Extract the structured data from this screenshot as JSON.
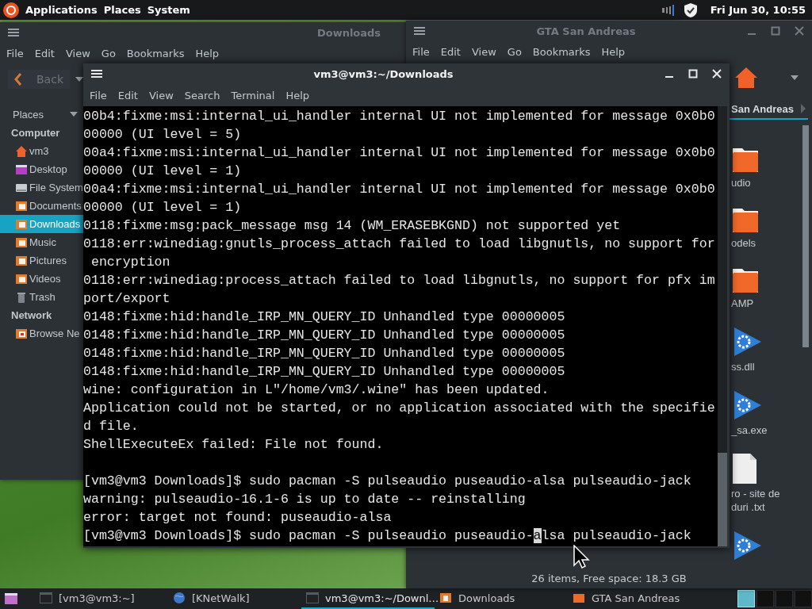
{
  "top_panel": {
    "menus": [
      "Applications",
      "Places",
      "System"
    ],
    "clock": "Fri Jun 30, 10:55"
  },
  "downloads_window": {
    "title": "Downloads",
    "active": false,
    "menus": [
      "File",
      "Edit",
      "View",
      "Go",
      "Bookmarks",
      "Help"
    ],
    "back_button": {
      "label": "Back",
      "disabled": true
    },
    "places_label": "Places",
    "sidebar": [
      {
        "heading": "Computer",
        "items": [
          {
            "kind": "home",
            "label": "vm3",
            "selected": false
          },
          {
            "kind": "desktop",
            "label": "Desktop",
            "selected": false
          },
          {
            "kind": "drive",
            "label": "File System",
            "selected": false
          },
          {
            "kind": "folder",
            "label": "Documents",
            "selected": false
          },
          {
            "kind": "folder",
            "label": "Downloads",
            "selected": true
          },
          {
            "kind": "folder",
            "label": "Music",
            "selected": false
          },
          {
            "kind": "folder",
            "label": "Pictures",
            "selected": false
          },
          {
            "kind": "folder",
            "label": "Videos",
            "selected": false
          },
          {
            "kind": "trash",
            "label": "Trash",
            "selected": false
          }
        ]
      },
      {
        "heading": "Network",
        "items": [
          {
            "kind": "network",
            "label": "Browse Ne",
            "selected": false
          }
        ]
      }
    ]
  },
  "gta_window": {
    "title": "GTA San Andreas",
    "active": false,
    "menus": [
      "File",
      "Edit",
      "View",
      "Go",
      "Bookmarks",
      "Help"
    ],
    "path_button": "San Andreas",
    "files": [
      {
        "kind": "folder",
        "name": "udio"
      },
      {
        "kind": "folder",
        "name": "odels"
      },
      {
        "kind": "folder",
        "name": "AMP"
      },
      {
        "kind": "executable",
        "name": "ss.dll"
      },
      {
        "kind": "executable",
        "name": "_sa.exe"
      },
      {
        "kind": "text",
        "name": "ro - site de duri .txt"
      },
      {
        "kind": "executable"
      }
    ],
    "status": "26 items, Free space: 18.3 GB"
  },
  "terminal": {
    "title": "vm3@vm3:~/Downloads",
    "active": true,
    "menus": [
      "File",
      "Edit",
      "View",
      "Search",
      "Terminal",
      "Help"
    ],
    "lines": [
      {
        "kind": "text",
        "text": "00b4:fixme:msi:internal_ui_handler internal UI not implemented for message 0x0b0"
      },
      {
        "kind": "text",
        "text": "00000 (UI level = 5)"
      },
      {
        "kind": "text",
        "text": "00a4:fixme:msi:internal_ui_handler internal UI not implemented for message 0x0b0"
      },
      {
        "kind": "text",
        "text": "00000 (UI level = 1)"
      },
      {
        "kind": "text",
        "text": "00a4:fixme:msi:internal_ui_handler internal UI not implemented for message 0x0b0"
      },
      {
        "kind": "text",
        "text": "00000 (UI level = 1)"
      },
      {
        "kind": "text",
        "text": "0118:fixme:msg:pack_message msg 14 (WM_ERASEBKGND) not supported yet"
      },
      {
        "kind": "text",
        "text": "0118:err:winediag:gnutls_process_attach failed to load libgnutls, no support for"
      },
      {
        "kind": "text",
        "text": " encryption"
      },
      {
        "kind": "text",
        "text": "0118:err:winediag:process_attach failed to load libgnutls, no support for pfx im"
      },
      {
        "kind": "text",
        "text": "port/export"
      },
      {
        "kind": "text",
        "text": "0148:fixme:hid:handle_IRP_MN_QUERY_ID Unhandled type 00000005"
      },
      {
        "kind": "text",
        "text": "0148:fixme:hid:handle_IRP_MN_QUERY_ID Unhandled type 00000005"
      },
      {
        "kind": "text",
        "text": "0148:fixme:hid:handle_IRP_MN_QUERY_ID Unhandled type 00000005"
      },
      {
        "kind": "text",
        "text": "0148:fixme:hid:handle_IRP_MN_QUERY_ID Unhandled type 00000005"
      },
      {
        "kind": "text",
        "text": "wine: configuration in L\"/home/vm3/.wine\" has been updated."
      },
      {
        "kind": "text",
        "text": "Application could not be started, or no application associated with the specifie"
      },
      {
        "kind": "text",
        "text": "d file."
      },
      {
        "kind": "text",
        "text": "ShellExecuteEx failed: File not found."
      },
      {
        "kind": "blank"
      },
      {
        "kind": "text",
        "text": "[vm3@vm3 Downloads]$ sudo pacman -S pulseaudio puseaudio-alsa pulseaudio-jack"
      },
      {
        "kind": "text",
        "text": "warning: pulseaudio-16.1-6 is up to date -- reinstalling"
      },
      {
        "kind": "text",
        "text": "error: target not found: puseaudio-alsa"
      },
      {
        "kind": "cursor",
        "before": "[vm3@vm3 Downloads]$ sudo pacman -S pulseaudio puseaudio-",
        "cursor": "a",
        "after": "lsa pulseaudio-jack"
      }
    ]
  },
  "taskbar": {
    "items": [
      {
        "kind": "terminal",
        "label": "[vm3@vm3:~]",
        "selected": false
      },
      {
        "kind": "globe",
        "label": "[KNetWalk]",
        "selected": false
      },
      {
        "kind": "terminal",
        "label": "vm3@vm3:~/Downl…",
        "selected": true
      },
      {
        "kind": "downloads",
        "label": "Downloads",
        "selected": false
      },
      {
        "kind": "folder",
        "label": "GTA San Andreas",
        "selected": false
      }
    ],
    "workspaces": [
      {
        "selected": true
      },
      {
        "selected": false
      },
      {
        "selected": false
      },
      {
        "selected": false
      }
    ]
  }
}
